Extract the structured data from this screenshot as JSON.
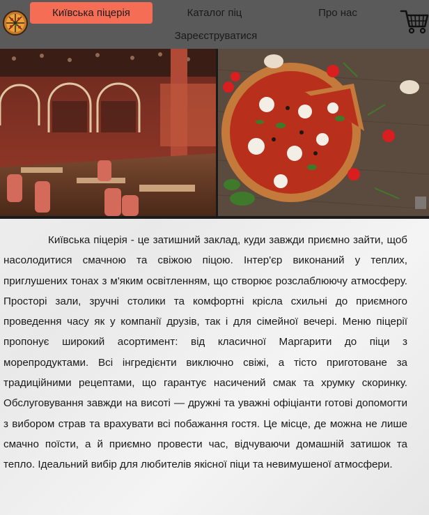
{
  "nav": {
    "items": [
      {
        "label": "Київська піцерія",
        "active": true
      },
      {
        "label": "Каталог піц",
        "active": false
      },
      {
        "label": "Про нас",
        "active": false
      },
      {
        "label": "Зареєструватися",
        "active": false
      }
    ],
    "logo_icon": "pizza-logo-icon",
    "cart_icon": "shopping-cart-icon"
  },
  "colors": {
    "navbar_bg": "#5a5a5a",
    "active_tab": "#f56d55",
    "page_bg": "#efefef",
    "photo_strip_bg": "#1b1b1b"
  },
  "content": {
    "description": "Київська піцерія - це затишний заклад, куди завжди приємно зайти, щоб насолодитися смачною та свіжою піцою. Інтер'єр виконаний у теплих, приглушених тонах з м'яким освітленням, що створює розслаблюючу атмосферу. Просторі зали, зручні столики та комфортні крісла схильні до приємного проведення часу як у компанії друзів, так і для сімейної вечері. Меню піцерії пропонує широкий асортимент: від класичної Маргарити до піци з морепродуктами. Всі інгредієнти виключно свіжі, а тісто приготоване за традиційними рецептами, що гарантує насичений смак та хрумку скоринку. Обслуговування завжди на висоті — дружні та уважні офіціанти готові допомогти з вибором страв та врахувати всі побажання гостя. Це місце, де можна не лише смачно поїсти, а й приємно провести час, відчуваючи домашній затишок та тепло. Ідеальний вибір для любителів якісної піци та невимушеної атмосфери."
  }
}
